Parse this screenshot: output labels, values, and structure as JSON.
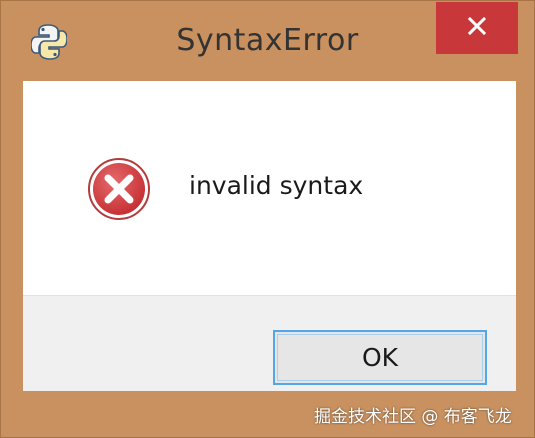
{
  "window": {
    "title": "SyntaxError",
    "frame_color": "#c9915f",
    "close_button_color": "#c8383b"
  },
  "titlebar": {
    "app_icon": "python-icon",
    "close_icon": "close-icon"
  },
  "dialog": {
    "status_icon": "error-icon",
    "message": "invalid syntax",
    "ok_label": "OK"
  },
  "watermark": {
    "text": "掘金技术社区 @ 布客飞龙"
  }
}
